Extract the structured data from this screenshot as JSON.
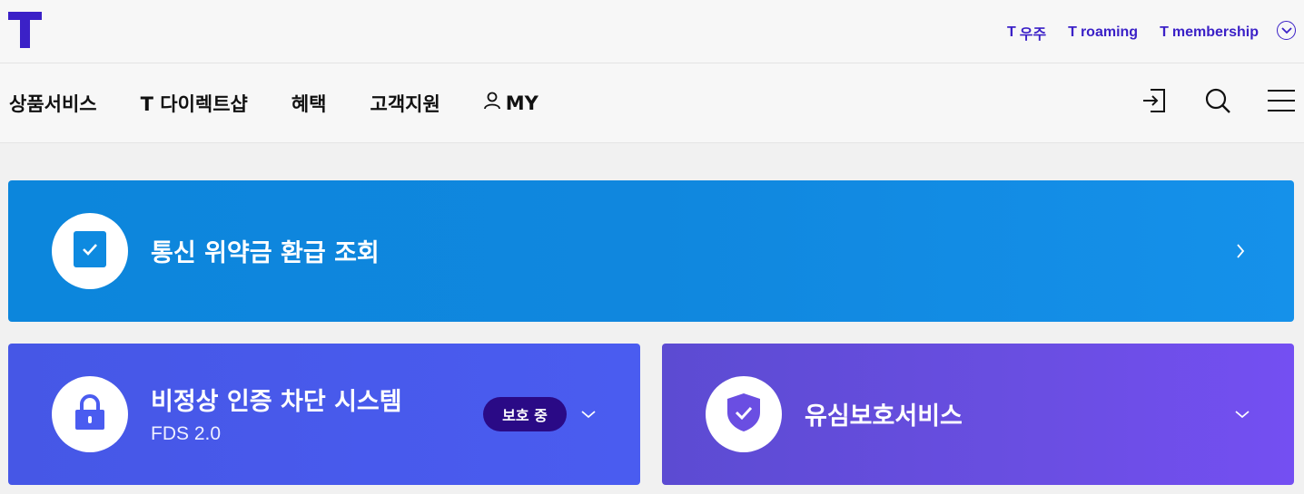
{
  "header": {
    "logo_icon": "t-logo-icon",
    "util_links": [
      {
        "mark": "T",
        "label": "우주"
      },
      {
        "mark": "T",
        "label": "roaming"
      },
      {
        "mark": "T",
        "label": "membership"
      }
    ],
    "util_toggle_icon": "chevron-down-circle-icon"
  },
  "gnb": {
    "items": [
      {
        "label": "상품서비스"
      },
      {
        "label": "T 다이렉트샵"
      },
      {
        "label": "혜택"
      },
      {
        "label": "고객지원"
      },
      {
        "label": "MY",
        "icon": "user-icon"
      }
    ],
    "icons": [
      "login-icon",
      "search-icon",
      "menu-icon"
    ]
  },
  "cards": {
    "refund": {
      "title": "통신 위약금 환급 조회",
      "icon": "checkbox-icon",
      "arrow_icon": "chevron-right-icon",
      "color": "#0e8ae0"
    },
    "fds": {
      "title": "비정상 인증 차단 시스템",
      "subtitle": "FDS 2.0",
      "badge": "보호 중",
      "icon": "lock-icon",
      "arrow_icon": "chevron-down-icon",
      "color": "#4a5cf0"
    },
    "usim": {
      "title": "유심보호서비스",
      "icon": "shield-check-icon",
      "arrow_icon": "chevron-down-icon",
      "color": "#6a4ee2"
    }
  },
  "colors": {
    "brand": "#3b21c7",
    "badge_bg": "#2a0a86"
  }
}
